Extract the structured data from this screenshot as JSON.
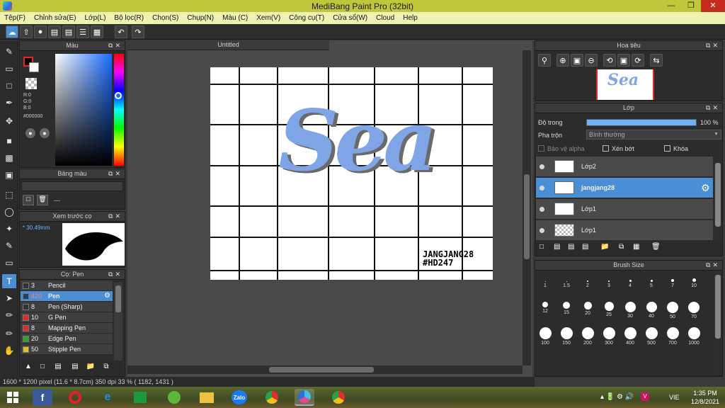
{
  "window": {
    "title": "MediBang Paint Pro (32bit)"
  },
  "menu": [
    "Tệp(F)",
    "Chỉnh sửa(E)",
    "Lớp(L)",
    "Bộ lọc(R)",
    "Chọn(S)",
    "Chụp(N)",
    "Màu (C)",
    "Xem(V)",
    "Công cụ(T)",
    "Cửa sổ(W)",
    "Cloud",
    "Help"
  ],
  "color_panel": {
    "title": "Màu",
    "r": "R:0",
    "g": "G:0",
    "b": "B:0",
    "hex": "#000000"
  },
  "palette_panel": {
    "title": "Bảng màu",
    "value": "---"
  },
  "brush_preview": {
    "title": "Xem trước cọ",
    "size": "30.49mm"
  },
  "brush_panel": {
    "title": "Cọ: Pen",
    "items": [
      {
        "size": "3",
        "name": "Pencil",
        "color": "#333333"
      },
      {
        "size": "420",
        "name": "Pen",
        "color": "#1f3f66"
      },
      {
        "size": "8",
        "name": "Pen (Sharp)",
        "color": "#333333"
      },
      {
        "size": "10",
        "name": "G Pen",
        "color": "#e02a2a"
      },
      {
        "size": "8",
        "name": "Mapping Pen",
        "color": "#e02a2a"
      },
      {
        "size": "20",
        "name": "Edge Pen",
        "color": "#2aa52a"
      },
      {
        "size": "50",
        "name": "Stipple Pen",
        "color": "#e0c020"
      }
    ]
  },
  "document": {
    "tab": "Untitled",
    "art_title": "Sea",
    "signature_line1": "JANGJANG28",
    "signature_line2": "#HD247"
  },
  "navigator": {
    "title": "Hoa tiêu"
  },
  "layer_panel": {
    "title": "Lớp",
    "opacity_label": "Độ trong",
    "opacity_value": "100 %",
    "opacity_fraction": 1.0,
    "blend_label": "Pha trộn",
    "blend_value": "Bình thường",
    "protect_alpha": "Bảo vệ alpha",
    "clipping": "Xén bớt",
    "lock": "Khóa",
    "layers": [
      {
        "name": "Lớp2",
        "selected": false
      },
      {
        "name": "jangjang28",
        "selected": true
      },
      {
        "name": "Lớp1",
        "selected": false
      },
      {
        "name": "Lớp1",
        "selected": false
      }
    ]
  },
  "brush_size_panel": {
    "title": "Brush Size",
    "sizes": [
      "1",
      "1.5",
      "2",
      "3",
      "4",
      "5",
      "7",
      "10",
      "12",
      "15",
      "20",
      "25",
      "30",
      "40",
      "50",
      "70",
      "100",
      "150",
      "200",
      "300",
      "400",
      "500",
      "700",
      "1000"
    ]
  },
  "status": "1600 * 1200 pixel   (11.6 * 8.7cm)   350 dpi   33 %   ( 1182, 1431 )",
  "taskbar": {
    "time": "1:35 PM",
    "date": "12/8/2021",
    "lang": "VIE"
  },
  "colors": {
    "accent": "#4a8fd6",
    "titlebar": "#c1c73a",
    "menubar": "#eef2b0"
  }
}
